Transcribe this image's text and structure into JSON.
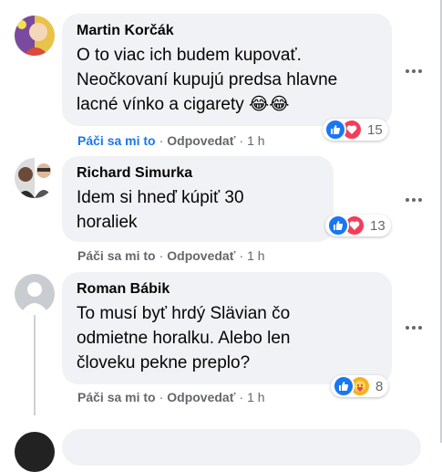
{
  "comments": [
    {
      "author": "Martin Korčák",
      "text": "O to viac ich budem kupovať.\nNeočkovaní kupujú predsa hlavne\nlacné vínko a cigarety 😂😂",
      "reaction_count": "15",
      "like_label": "Páči sa mi to",
      "reply_label": "Odpovedať",
      "time": "1 h"
    },
    {
      "author": "Richard Simurka",
      "text": "Idem si hneď kúpiť 30\nhoraliek",
      "reaction_count": "13",
      "like_label": "Páči sa mi to",
      "reply_label": "Odpovedať",
      "time": "1 h"
    },
    {
      "author": "Roman Bábik",
      "text": "To musí byť hrdý Slävian čo\nodmietne horalku. Alebo len\nčloveku pekne preplo?",
      "reaction_count": "8",
      "like_label": "Páči sa mi to",
      "reply_label": "Odpovedať",
      "time": "1 h"
    }
  ],
  "colors": {
    "accent": "#1877f2",
    "bubble": "#f0f2f5",
    "secondary_text": "#65676b",
    "love": "#f33e58",
    "care": "#f7b125"
  }
}
